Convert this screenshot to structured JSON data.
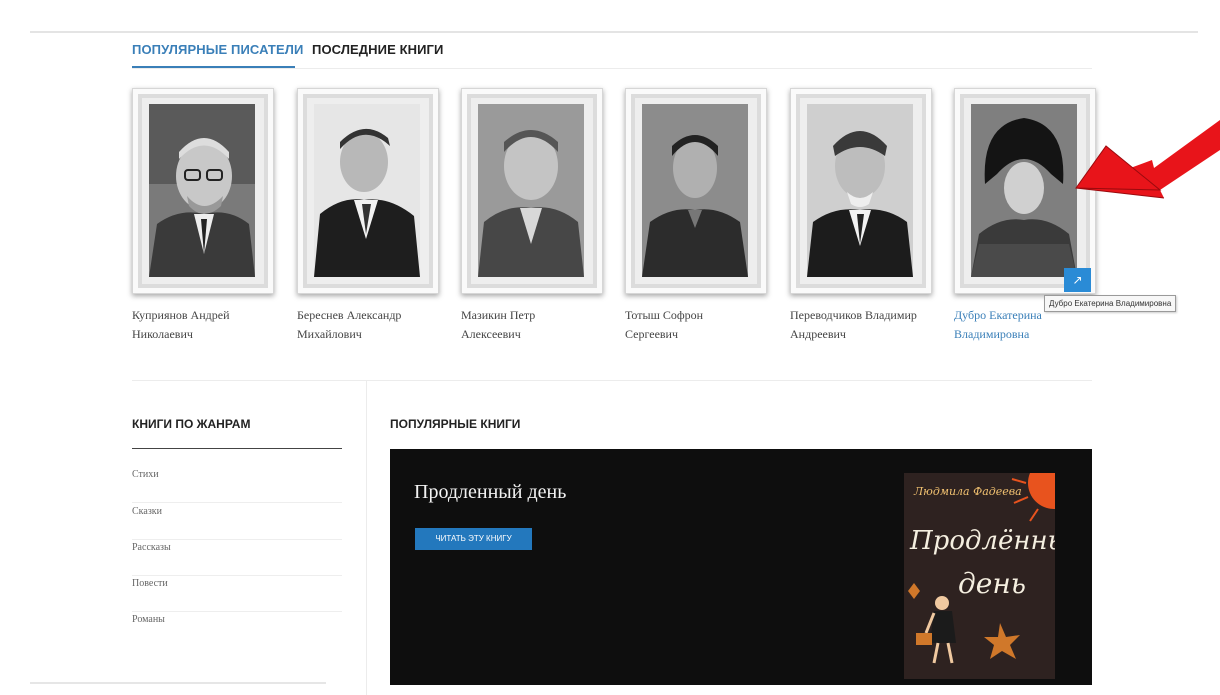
{
  "tabs": {
    "popular_writers": "ПОПУЛЯРНЫЕ ПИСАТЕЛИ",
    "latest_books": "ПОСЛЕДНИЕ КНИГИ"
  },
  "authors": [
    {
      "line1": "Куприянов Андрей",
      "line2": "Николаевич"
    },
    {
      "line1": "Береснев Александр",
      "line2": "Михайлович"
    },
    {
      "line1": "Мазикин Петр",
      "line2": "Алексеевич"
    },
    {
      "line1": "Тотыш Софрон",
      "line2": "Сергеевич"
    },
    {
      "line1": "Переводчиков Владимир",
      "line2": "Андреевич"
    },
    {
      "line1": "Дубро Екатерина",
      "line2": "Владимировна"
    }
  ],
  "edit_icon": "external-link-icon",
  "tooltip": "Дубро Екатерина Владимировна",
  "genres": {
    "title": "КНИГИ ПО ЖАНРАМ",
    "items": [
      "Стихи",
      "Сказки",
      "Рассказы",
      "Повести",
      "Романы"
    ]
  },
  "popular_books": {
    "title": "ПОПУЛЯРНЫЕ КНИГИ",
    "featured_title": "Продленный день",
    "read_button": "ЧИТАТЬ ЭТУ КНИГУ",
    "cover_author": "Людмила Фадеева",
    "cover_title_line1": "Продлённый",
    "cover_title_line2": "день"
  },
  "colors": {
    "accent": "#3a7fb8",
    "button": "#2378bd",
    "edit_button": "#2a8bd6",
    "arrow": "#e8141a",
    "banner_bg": "#0e0e0e"
  }
}
